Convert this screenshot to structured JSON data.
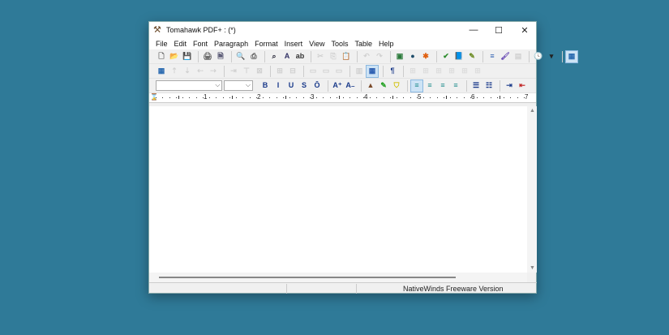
{
  "window": {
    "title": "Tomahawk PDF+ : (*)",
    "minimize": "—",
    "maximize": "☐",
    "close": "✕"
  },
  "menu": [
    "File",
    "Edit",
    "Font",
    "Paragraph",
    "Format",
    "Insert",
    "View",
    "Tools",
    "Table",
    "Help"
  ],
  "toolbar1": [
    [
      {
        "n": "new-document",
        "g": "🗋",
        "c": "#555"
      },
      {
        "n": "open-folder",
        "g": "📂",
        "c": "#d9a400"
      },
      {
        "n": "save",
        "g": "💾",
        "c": "#2a5db0"
      }
    ],
    [
      {
        "n": "print-setup",
        "g": "🖨",
        "c": "#666"
      },
      {
        "n": "page-setup",
        "g": "🗎",
        "c": "#335"
      }
    ],
    [
      {
        "n": "print-preview",
        "g": "🔍",
        "c": "#339"
      },
      {
        "n": "print",
        "g": "⎙",
        "c": "#555"
      }
    ],
    [
      {
        "n": "find",
        "g": "⌕",
        "c": "#223"
      },
      {
        "n": "find-next",
        "g": "A",
        "c": "#336"
      },
      {
        "n": "replace",
        "g": "ab",
        "c": "#333"
      }
    ],
    [
      {
        "n": "cut",
        "g": "✂",
        "c": "#999",
        "d": true
      },
      {
        "n": "copy",
        "g": "⎘",
        "c": "#999",
        "d": true
      },
      {
        "n": "paste",
        "g": "📋",
        "c": "#b08020"
      }
    ],
    [
      {
        "n": "undo",
        "g": "↶",
        "c": "#999",
        "d": true
      },
      {
        "n": "redo",
        "g": "↷",
        "c": "#999",
        "d": true
      }
    ],
    [
      {
        "n": "insert-image",
        "g": "▣",
        "c": "#2a7a3a"
      },
      {
        "n": "insert-object",
        "g": "●",
        "c": "#1f4d6a"
      },
      {
        "n": "insert-symbol",
        "g": "✱",
        "c": "#e06010"
      }
    ],
    [
      {
        "n": "spell-check",
        "g": "✔",
        "c": "#2a8a2a"
      },
      {
        "n": "dictionary",
        "g": "📘",
        "c": "#2a6ab0"
      },
      {
        "n": "thesaurus",
        "g": "✎",
        "c": "#6a8a20"
      }
    ],
    [
      {
        "n": "page-break",
        "g": "≡",
        "c": "#2a5db0"
      },
      {
        "n": "format-painter",
        "g": "🖌",
        "c": "#6040b0"
      },
      {
        "n": "select-all",
        "g": "▤",
        "c": "#999",
        "d": true
      }
    ],
    [
      {
        "n": "insert-date",
        "g": "🕓",
        "c": "#2a6ab0"
      },
      {
        "n": "dropdown-arrow",
        "g": "▾",
        "c": "#222"
      }
    ],
    [
      {
        "n": "options",
        "g": "▦",
        "c": "#2a6ab0",
        "a": true
      }
    ]
  ],
  "toolbar2": [
    [
      {
        "n": "insert-table",
        "g": "▦",
        "c": "#2a6ab0"
      },
      {
        "n": "insert-row-above",
        "g": "⇡",
        "c": "#999",
        "d": true
      },
      {
        "n": "insert-row-below",
        "g": "⇣",
        "c": "#999",
        "d": true
      },
      {
        "n": "insert-col-left",
        "g": "⇠",
        "c": "#999",
        "d": true
      },
      {
        "n": "insert-col-right",
        "g": "⇢",
        "c": "#999",
        "d": true
      }
    ],
    [
      {
        "n": "delete-col",
        "g": "⇥",
        "c": "#999",
        "d": true
      },
      {
        "n": "delete-row",
        "g": "⊤",
        "c": "#999",
        "d": true
      },
      {
        "n": "delete-cell",
        "g": "⊠",
        "c": "#999",
        "d": true
      }
    ],
    [
      {
        "n": "merge-cells",
        "g": "⊞",
        "c": "#999",
        "d": true
      },
      {
        "n": "split-cells",
        "g": "⊟",
        "c": "#999",
        "d": true
      }
    ],
    [
      {
        "n": "align-top",
        "g": "▭",
        "c": "#999",
        "d": true
      },
      {
        "n": "align-middle",
        "g": "▭",
        "c": "#999",
        "d": true
      },
      {
        "n": "align-bottom",
        "g": "▭",
        "c": "#999",
        "d": true
      }
    ],
    [
      {
        "n": "cell-shading",
        "g": "▥",
        "c": "#999",
        "d": true
      },
      {
        "n": "show-gridlines",
        "g": "▦",
        "c": "#2a5db0",
        "a": true
      }
    ],
    [
      {
        "n": "pilcrow",
        "g": "¶",
        "c": "#1a3a8a"
      }
    ],
    [
      {
        "n": "border-all",
        "g": "⊞",
        "c": "#bbb",
        "d": true
      },
      {
        "n": "border-left",
        "g": "⊞",
        "c": "#bbb",
        "d": true
      },
      {
        "n": "border-top",
        "g": "⊞",
        "c": "#bbb",
        "d": true
      },
      {
        "n": "border-right",
        "g": "⊞",
        "c": "#bbb",
        "d": true
      },
      {
        "n": "border-bottom",
        "g": "⊞",
        "c": "#bbb",
        "d": true
      },
      {
        "n": "border-none",
        "g": "⊞",
        "c": "#bbb",
        "d": true
      }
    ]
  ],
  "toolbar3": [
    [
      {
        "n": "bold",
        "g": "B",
        "c": "#1a3a8a"
      },
      {
        "n": "italic",
        "g": "I",
        "c": "#1a3a8a"
      },
      {
        "n": "underline",
        "g": "U",
        "c": "#1a3a8a"
      },
      {
        "n": "strikethrough",
        "g": "S",
        "c": "#1a3a8a"
      },
      {
        "n": "overline",
        "g": "Ō",
        "c": "#1a3a8a"
      }
    ],
    [
      {
        "n": "superscript",
        "g": "A⁺",
        "c": "#1a3a8a"
      },
      {
        "n": "subscript",
        "g": "A₋",
        "c": "#1a3a8a"
      }
    ],
    [
      {
        "n": "text-color",
        "g": "▲",
        "c": "#7a4a2a"
      },
      {
        "n": "highlight-green",
        "g": "✎",
        "c": "#20a020"
      },
      {
        "n": "highlight-yellow",
        "g": "⛉",
        "c": "#d0c000"
      }
    ],
    [
      {
        "n": "align-left",
        "g": "≡",
        "c": "#1a8a8a",
        "a": true
      },
      {
        "n": "align-center",
        "g": "≡",
        "c": "#1a8a8a"
      },
      {
        "n": "align-right",
        "g": "≡",
        "c": "#1a8a8a"
      },
      {
        "n": "justify",
        "g": "≡",
        "c": "#1a8a8a"
      }
    ],
    [
      {
        "n": "bullet-list",
        "g": "☰",
        "c": "#1a3a8a"
      },
      {
        "n": "numbered-list",
        "g": "☷",
        "c": "#1a3a8a"
      }
    ],
    [
      {
        "n": "indent-increase",
        "g": "⇥",
        "c": "#1a3a8a"
      },
      {
        "n": "indent-decrease",
        "g": "⇤",
        "c": "#c02020"
      }
    ]
  ],
  "font": {
    "family": "",
    "size": ""
  },
  "ruler": [
    "1",
    "2",
    "3",
    "4",
    "5",
    "6",
    "7"
  ],
  "status": {
    "text": "NativeWinds Freeware Version"
  }
}
